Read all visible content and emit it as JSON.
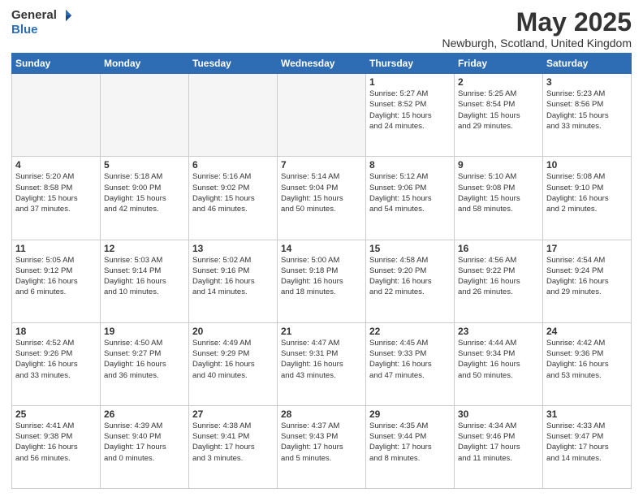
{
  "header": {
    "logo_general": "General",
    "logo_blue": "Blue",
    "month_title": "May 2025",
    "location": "Newburgh, Scotland, United Kingdom"
  },
  "days_of_week": [
    "Sunday",
    "Monday",
    "Tuesday",
    "Wednesday",
    "Thursday",
    "Friday",
    "Saturday"
  ],
  "weeks": [
    [
      {
        "day": "",
        "info": ""
      },
      {
        "day": "",
        "info": ""
      },
      {
        "day": "",
        "info": ""
      },
      {
        "day": "",
        "info": ""
      },
      {
        "day": "1",
        "info": "Sunrise: 5:27 AM\nSunset: 8:52 PM\nDaylight: 15 hours\nand 24 minutes."
      },
      {
        "day": "2",
        "info": "Sunrise: 5:25 AM\nSunset: 8:54 PM\nDaylight: 15 hours\nand 29 minutes."
      },
      {
        "day": "3",
        "info": "Sunrise: 5:23 AM\nSunset: 8:56 PM\nDaylight: 15 hours\nand 33 minutes."
      }
    ],
    [
      {
        "day": "4",
        "info": "Sunrise: 5:20 AM\nSunset: 8:58 PM\nDaylight: 15 hours\nand 37 minutes."
      },
      {
        "day": "5",
        "info": "Sunrise: 5:18 AM\nSunset: 9:00 PM\nDaylight: 15 hours\nand 42 minutes."
      },
      {
        "day": "6",
        "info": "Sunrise: 5:16 AM\nSunset: 9:02 PM\nDaylight: 15 hours\nand 46 minutes."
      },
      {
        "day": "7",
        "info": "Sunrise: 5:14 AM\nSunset: 9:04 PM\nDaylight: 15 hours\nand 50 minutes."
      },
      {
        "day": "8",
        "info": "Sunrise: 5:12 AM\nSunset: 9:06 PM\nDaylight: 15 hours\nand 54 minutes."
      },
      {
        "day": "9",
        "info": "Sunrise: 5:10 AM\nSunset: 9:08 PM\nDaylight: 15 hours\nand 58 minutes."
      },
      {
        "day": "10",
        "info": "Sunrise: 5:08 AM\nSunset: 9:10 PM\nDaylight: 16 hours\nand 2 minutes."
      }
    ],
    [
      {
        "day": "11",
        "info": "Sunrise: 5:05 AM\nSunset: 9:12 PM\nDaylight: 16 hours\nand 6 minutes."
      },
      {
        "day": "12",
        "info": "Sunrise: 5:03 AM\nSunset: 9:14 PM\nDaylight: 16 hours\nand 10 minutes."
      },
      {
        "day": "13",
        "info": "Sunrise: 5:02 AM\nSunset: 9:16 PM\nDaylight: 16 hours\nand 14 minutes."
      },
      {
        "day": "14",
        "info": "Sunrise: 5:00 AM\nSunset: 9:18 PM\nDaylight: 16 hours\nand 18 minutes."
      },
      {
        "day": "15",
        "info": "Sunrise: 4:58 AM\nSunset: 9:20 PM\nDaylight: 16 hours\nand 22 minutes."
      },
      {
        "day": "16",
        "info": "Sunrise: 4:56 AM\nSunset: 9:22 PM\nDaylight: 16 hours\nand 26 minutes."
      },
      {
        "day": "17",
        "info": "Sunrise: 4:54 AM\nSunset: 9:24 PM\nDaylight: 16 hours\nand 29 minutes."
      }
    ],
    [
      {
        "day": "18",
        "info": "Sunrise: 4:52 AM\nSunset: 9:26 PM\nDaylight: 16 hours\nand 33 minutes."
      },
      {
        "day": "19",
        "info": "Sunrise: 4:50 AM\nSunset: 9:27 PM\nDaylight: 16 hours\nand 36 minutes."
      },
      {
        "day": "20",
        "info": "Sunrise: 4:49 AM\nSunset: 9:29 PM\nDaylight: 16 hours\nand 40 minutes."
      },
      {
        "day": "21",
        "info": "Sunrise: 4:47 AM\nSunset: 9:31 PM\nDaylight: 16 hours\nand 43 minutes."
      },
      {
        "day": "22",
        "info": "Sunrise: 4:45 AM\nSunset: 9:33 PM\nDaylight: 16 hours\nand 47 minutes."
      },
      {
        "day": "23",
        "info": "Sunrise: 4:44 AM\nSunset: 9:34 PM\nDaylight: 16 hours\nand 50 minutes."
      },
      {
        "day": "24",
        "info": "Sunrise: 4:42 AM\nSunset: 9:36 PM\nDaylight: 16 hours\nand 53 minutes."
      }
    ],
    [
      {
        "day": "25",
        "info": "Sunrise: 4:41 AM\nSunset: 9:38 PM\nDaylight: 16 hours\nand 56 minutes."
      },
      {
        "day": "26",
        "info": "Sunrise: 4:39 AM\nSunset: 9:40 PM\nDaylight: 17 hours\nand 0 minutes."
      },
      {
        "day": "27",
        "info": "Sunrise: 4:38 AM\nSunset: 9:41 PM\nDaylight: 17 hours\nand 3 minutes."
      },
      {
        "day": "28",
        "info": "Sunrise: 4:37 AM\nSunset: 9:43 PM\nDaylight: 17 hours\nand 5 minutes."
      },
      {
        "day": "29",
        "info": "Sunrise: 4:35 AM\nSunset: 9:44 PM\nDaylight: 17 hours\nand 8 minutes."
      },
      {
        "day": "30",
        "info": "Sunrise: 4:34 AM\nSunset: 9:46 PM\nDaylight: 17 hours\nand 11 minutes."
      },
      {
        "day": "31",
        "info": "Sunrise: 4:33 AM\nSunset: 9:47 PM\nDaylight: 17 hours\nand 14 minutes."
      }
    ]
  ]
}
